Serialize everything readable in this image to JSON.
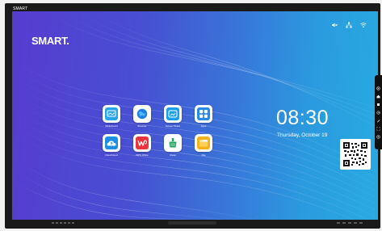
{
  "device": {
    "top_label": "SMART",
    "brand": "SMART."
  },
  "clock": {
    "time": "08:30",
    "date": "Thursday, October 19"
  },
  "apps": [
    {
      "label": "Whiteboard",
      "icon": "whiteboard-icon",
      "color": "#2aa6e8"
    },
    {
      "label": "Browser",
      "icon": "browser-icon",
      "color": "#1b7fe6"
    },
    {
      "label": "Screen Share",
      "icon": "screen-share-icon",
      "color": "#1aa0e8"
    },
    {
      "label": "Apps",
      "icon": "apps-icon",
      "color": "#2a8ae6"
    },
    {
      "label": "Files/Cloud",
      "icon": "cloud-upload-icon",
      "color": "#1f8fe6"
    },
    {
      "label": "WPS Office",
      "icon": "wps-office-icon",
      "color": "#e8343c"
    },
    {
      "label": "Clean",
      "icon": "clean-icon",
      "color": "#1ca35a"
    },
    {
      "label": "File",
      "icon": "folder-icon",
      "color": "#f5b31b"
    }
  ],
  "status_icons": [
    "mute-icon",
    "network-icon",
    "wifi-icon"
  ],
  "side_toolbar": [
    "settings-icon",
    "home-icon",
    "stop-icon",
    "input-icon",
    "pen-icon",
    "screenshot-icon",
    "apps-grid-icon"
  ],
  "colors": {
    "accent": "#2aa6e8",
    "wps_red": "#e8343c",
    "clean_green": "#1ca35a",
    "folder_yellow": "#f5b31b"
  }
}
